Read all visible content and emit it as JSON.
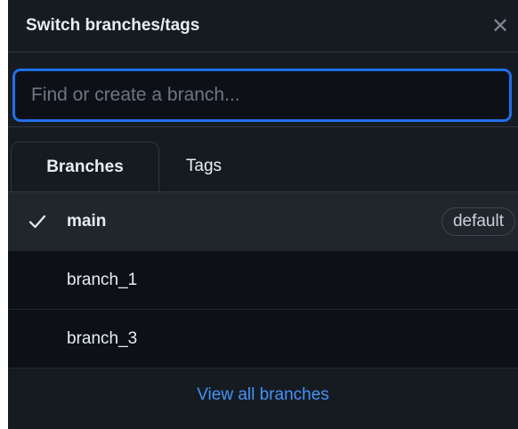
{
  "header": {
    "title": "Switch branches/tags",
    "close_glyph": "✕"
  },
  "search": {
    "placeholder": "Find or create a branch...",
    "value": ""
  },
  "tabs": [
    {
      "label": "Branches",
      "active": true
    },
    {
      "label": "Tags",
      "active": false
    }
  ],
  "branches": [
    {
      "name": "main",
      "selected": true,
      "badge": "default",
      "check_icon": "check-icon"
    },
    {
      "name": "branch_1",
      "selected": false
    },
    {
      "name": "branch_3",
      "selected": false
    }
  ],
  "footer": {
    "link_label": "View all branches"
  },
  "colors": {
    "panel_bg": "#161b22",
    "list_bg": "#0d1117",
    "selected_row_bg": "#21262d",
    "focus_border": "#1f6feb",
    "link": "#4493f8"
  }
}
